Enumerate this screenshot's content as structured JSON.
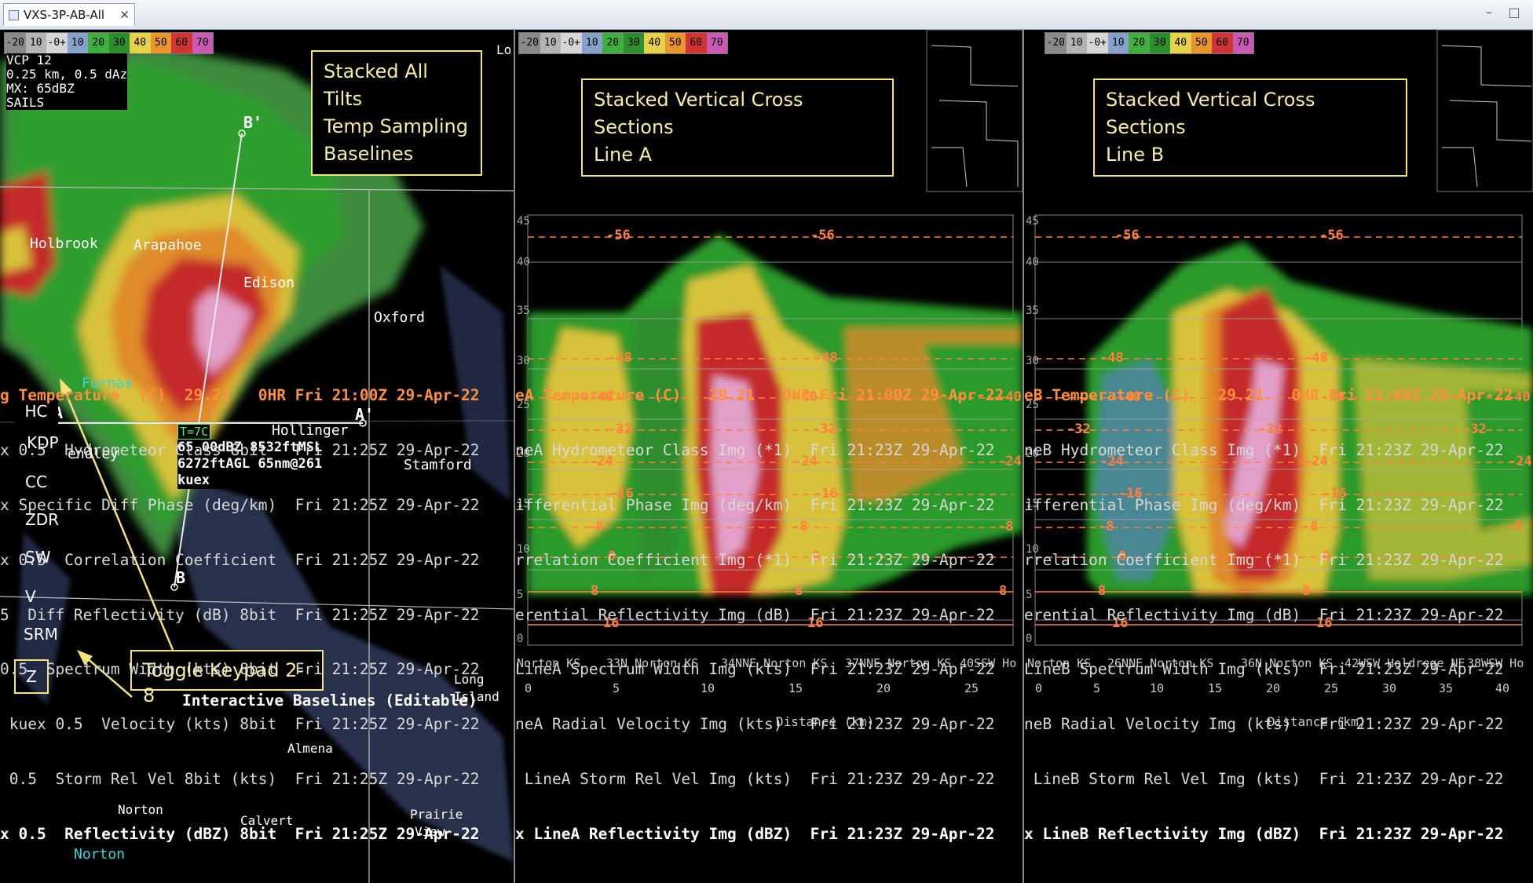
{
  "window": {
    "tab_title": "VXS-3P-AB-All",
    "tab_close": "✕",
    "minimize": "–",
    "maximize": "□"
  },
  "colorbar": [
    "-20",
    "10",
    "-0+",
    "10",
    "20",
    "30",
    "40",
    "50",
    "60",
    "70"
  ],
  "colors": {
    "frame": "#000000",
    "annotation_border": "#f3e27a",
    "temperature": "#ff8f3a"
  },
  "pane1": {
    "radar_info": [
      "VCP 12",
      "0.25 km, 0.5 dAz",
      "MX: 65dBZ",
      "SAILS"
    ],
    "annotation": [
      "Stacked All Tilts",
      "Temp Sampling",
      "Baselines"
    ],
    "towns": [
      "Holbrook",
      "Arapahoe",
      "Edison",
      "Oxford",
      "Hollinger",
      "Stamford",
      "Almena",
      "Norton",
      "Calvert",
      "Prairie",
      "View",
      "Long",
      "Island",
      "endley",
      "Lo"
    ],
    "counties": [
      "Furnas",
      "Norton"
    ],
    "baselines": {
      "a": "A",
      "a_prime": "A'",
      "b": "B",
      "b_prime": "B'",
      "t_label": "T=7C"
    },
    "sample": [
      "65.00dBZ 8532ftMSL",
      "6272ftAGL 65nm@261",
      "kuex"
    ],
    "keypad": [
      "HC",
      "KDP",
      "CC",
      "ZDR",
      "SW",
      "V",
      "SRM",
      "Z"
    ],
    "toggle_label": "Toggle Keypad 2-8",
    "baseline_title": "Interactive Baselines (Editable)",
    "legend": [
      "g Temperature  (C)  29.21   0HR Fri 21:00Z 29-Apr-22",
      "x 0.5  Hydrometeor Class 8bit   Fri 21:25Z 29-Apr-22",
      "x Specific Diff Phase (deg/km)  Fri 21:25Z 29-Apr-22",
      "x 0.5  Correlation Coefficient  Fri 21:25Z 29-Apr-22",
      "5  Diff Reflectivity (dB) 8bit  Fri 21:25Z 29-Apr-22",
      "0.5  Spectrum Width (kts) 8bit  Fri 21:25Z 29-Apr-22",
      " kuex 0.5  Velocity (kts) 8bit  Fri 21:25Z 29-Apr-22",
      " 0.5  Storm Rel Vel 8bit (kts)  Fri 21:25Z 29-Apr-22",
      "x 0.5  Reflectivity (dBZ) 8bit  Fri 21:25Z 29-Apr-22"
    ]
  },
  "pane2": {
    "annotation": [
      "Stacked Vertical Cross Sections",
      "Line A"
    ],
    "heights": [
      "45",
      "40",
      "35",
      "30",
      "25",
      "20",
      "15",
      "10",
      "5",
      "0"
    ],
    "isotherms": [
      "-56",
      "-56",
      "-48",
      "-48",
      "-40",
      "-40",
      "-40",
      "-32",
      "-32",
      "-24",
      "-24",
      "-24",
      "-16",
      "-16",
      "-8",
      "-8",
      "-8",
      "0",
      "0",
      "8",
      "8",
      "8",
      "16",
      "16"
    ],
    "places": [
      "Norton KS",
      "33N Norton KS",
      "34NNE Norton KS",
      "37NNE Norton KS",
      "40SSW Ho"
    ],
    "distances": [
      "0",
      "5",
      "10",
      "15",
      "20",
      "25"
    ],
    "distance_label": "Distance (km)",
    "legend": [
      "eA Temperature (C)   29.21   0HR Fri 21:00Z 29-Apr-22",
      "neA Hydrometeor Class Img (*1)  Fri 21:23Z 29-Apr-22",
      "ifferential Phase Img (deg/km)  Fri 21:23Z 29-Apr-22",
      "rrelation Coefficient Img (*1)  Fri 21:23Z 29-Apr-22",
      "erential Reflectivity Img (dB)  Fri 21:23Z 29-Apr-22",
      "LineA Spectrum Width Img (kts)  Fri 21:23Z 29-Apr-22",
      "neA Radial Velocity Img (kts)   Fri 21:23Z 29-Apr-22",
      " LineA Storm Rel Vel Img (kts)  Fri 21:23Z 29-Apr-22",
      "x LineA Reflectivity Img (dBZ)  Fri 21:23Z 29-Apr-22"
    ]
  },
  "pane3": {
    "annotation": [
      "Stacked Vertical Cross Sections",
      "Line B"
    ],
    "heights": [
      "45",
      "40",
      "35",
      "30",
      "25",
      "20",
      "15",
      "10",
      "5",
      "0"
    ],
    "isotherms": [
      "-56",
      "-56",
      "-48",
      "-48",
      "-40",
      "-40",
      "-40",
      "-32",
      "-32",
      "-32",
      "-24",
      "-24",
      "-24",
      "-16",
      "-16",
      "-8",
      "-8",
      "-8",
      "0",
      "0",
      "8",
      "8",
      "16",
      "16"
    ],
    "places": [
      "Norton KS",
      "26NNE Norton KS",
      "36N Norton KS",
      "42WSW Holdrege NE",
      "38WSW Ho"
    ],
    "distances": [
      "0",
      "5",
      "10",
      "15",
      "20",
      "25",
      "30",
      "35",
      "40"
    ],
    "distance_label": "Distance (km)",
    "legend": [
      "eB Temperature (C)   29.21   0HR Fri 21:00Z 29-Apr-22",
      "neB Hydrometeor Class Img (*1)  Fri 21:23Z 29-Apr-22",
      "ifferential Phase Img (deg/km)  Fri 21:23Z 29-Apr-22",
      "rrelation Coefficient Img (*1)  Fri 21:23Z 29-Apr-22",
      "erential Reflectivity Img (dB)  Fri 21:23Z 29-Apr-22",
      "LineB Spectrum Width Img (kts)  Fri 21:23Z 29-Apr-22",
      "neB Radial Velocity Img (kts)   Fri 21:23Z 29-Apr-22",
      " LineB Storm Rel Vel Img (kts)  Fri 21:23Z 29-Apr-22",
      "x LineB Reflectivity Img (dBZ)  Fri 21:23Z 29-Apr-22"
    ]
  }
}
